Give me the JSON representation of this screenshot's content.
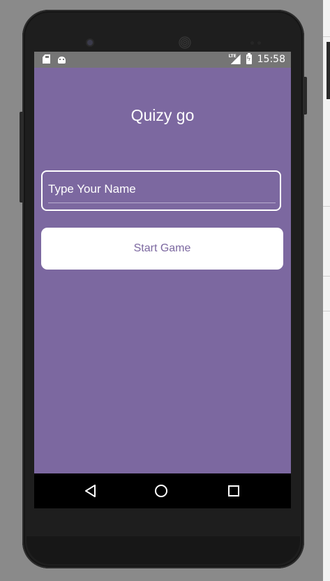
{
  "status_bar": {
    "network_type": "LTE",
    "time": "15:58",
    "icons": [
      "sd-card-icon",
      "android-icon",
      "signal-icon",
      "battery-charging-icon"
    ]
  },
  "app": {
    "title": "Quizy go",
    "name_input": {
      "placeholder": "Type Your Name",
      "value": ""
    },
    "start_button_label": "Start Game"
  },
  "nav_bar": {
    "icons": [
      "back-icon",
      "home-icon",
      "recent-apps-icon"
    ]
  },
  "colors": {
    "app_background": "#7c68a0",
    "status_bar": "#757575",
    "nav_bar": "#000000",
    "button_background": "#ffffff",
    "button_text": "#7c68a0"
  }
}
